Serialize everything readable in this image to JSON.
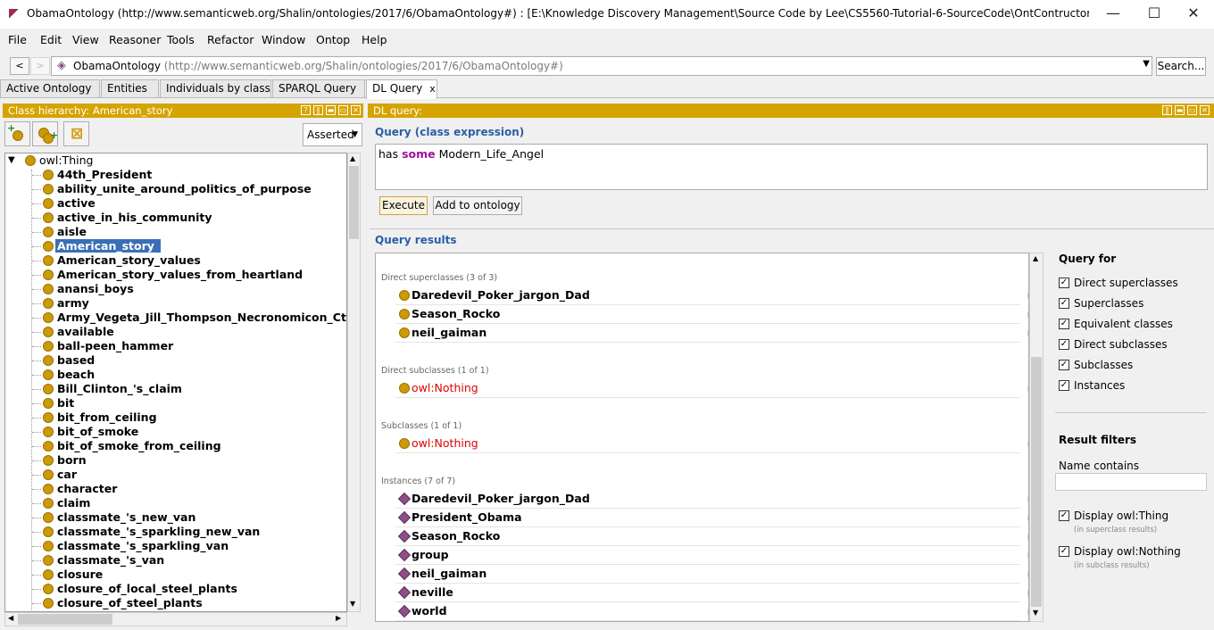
{
  "window": {
    "title": "ObamaOntology (http://www.semanticweb.org/Shalin/ontologies/2017/6/ObamaOntology#)  : [E:\\Knowledge Discovery Management\\Source Code by Lee\\CS5560-Tutorial-6-SourceCode\\OntContructor\\data\\MyDataSet\\Ob...",
    "minimize": "—",
    "maximize": "☐",
    "close": "✕"
  },
  "menu": [
    "File",
    "Edit",
    "View",
    "Reasoner",
    "Tools",
    "Refactor",
    "Window",
    "Ontop",
    "Help"
  ],
  "address": {
    "back": "<",
    "forward": ">",
    "ontology_name": "ObamaOntology",
    "ontology_iri": "(http://www.semanticweb.org/Shalin/ontologies/2017/6/ObamaOntology#)",
    "search_label": "Search..."
  },
  "tabs": [
    "Active Ontology",
    "Entities",
    "Individuals by class",
    "SPARQL Query",
    "DL Query"
  ],
  "tab_close": "x",
  "left_panel": {
    "header": "Class hierarchy: American_story",
    "dropdown_value": "Asserted",
    "root": "owl:Thing",
    "selected": "American_story",
    "classes": [
      "44th_President",
      "ability_unite_around_politics_of_purpose",
      "active",
      "active_in_his_community",
      "aisle",
      "American_story",
      "American_story_values",
      "American_story_values_from_heartland",
      "anansi_boys",
      "army",
      "Army_Vegeta_Jill_Thompson_Necronomicon_Cth",
      "available",
      "ball-peen_hammer",
      "based",
      "beach",
      "Bill_Clinton_'s_claim",
      "bit",
      "bit_from_ceiling",
      "bit_of_smoke",
      "bit_of_smoke_from_ceiling",
      "born",
      "car",
      "character",
      "claim",
      "classmate_'s_new_van",
      "classmate_'s_sparkling_new_van",
      "classmate_'s_sparkling_van",
      "classmate_'s_van",
      "closure",
      "closure_of_local_steel_plants",
      "closure_of_steel_plants"
    ]
  },
  "dl_query": {
    "header": "DL query:",
    "query_label": "Query (class expression)",
    "query_prefix": "has",
    "query_keyword": "some",
    "query_suffix": "Modern_Life_Angel",
    "execute_label": "Execute",
    "add_label": "Add to ontology",
    "results_label": "Query results",
    "help_glyph": "?",
    "groups": [
      {
        "title": "Direct superclasses (3 of 3)",
        "kind": "class",
        "items": [
          "Daredevil_Poker_jargon_Dad",
          "Season_Rocko",
          "neil_gaiman"
        ]
      },
      {
        "title": "Direct subclasses (1 of 1)",
        "kind": "nothing",
        "items": [
          "owl:Nothing"
        ]
      },
      {
        "title": "Subclasses (1 of 1)",
        "kind": "nothing",
        "items": [
          "owl:Nothing"
        ]
      },
      {
        "title": "Instances (7 of 7)",
        "kind": "individual",
        "items": [
          "Daredevil_Poker_jargon_Dad",
          "President_Obama",
          "Season_Rocko",
          "group",
          "neil_gaiman",
          "neville",
          "world"
        ]
      }
    ]
  },
  "query_for": {
    "title": "Query for",
    "options": [
      {
        "label": "Direct superclasses",
        "checked": true
      },
      {
        "label": "Superclasses",
        "checked": true
      },
      {
        "label": "Equivalent classes",
        "checked": true
      },
      {
        "label": "Direct subclasses",
        "checked": true
      },
      {
        "label": "Subclasses",
        "checked": true
      },
      {
        "label": "Instances",
        "checked": true
      }
    ]
  },
  "result_filters": {
    "title": "Result filters",
    "name_contains_label": "Name contains",
    "name_contains_value": "",
    "display_thing": "Display owl:Thing",
    "display_thing_note": "(in superclass results)",
    "display_nothing": "Display owl:Nothing",
    "display_nothing_note": "(in subclass results)"
  },
  "colors": {
    "panel_header": "#d5a400",
    "class_dot": "#cc9a06",
    "individual_diamond": "#8e4f89",
    "selection": "#3a6fb6",
    "section_title": "#2a5ea8",
    "keyword": "#a0119e",
    "nothing_text": "#e00000"
  }
}
